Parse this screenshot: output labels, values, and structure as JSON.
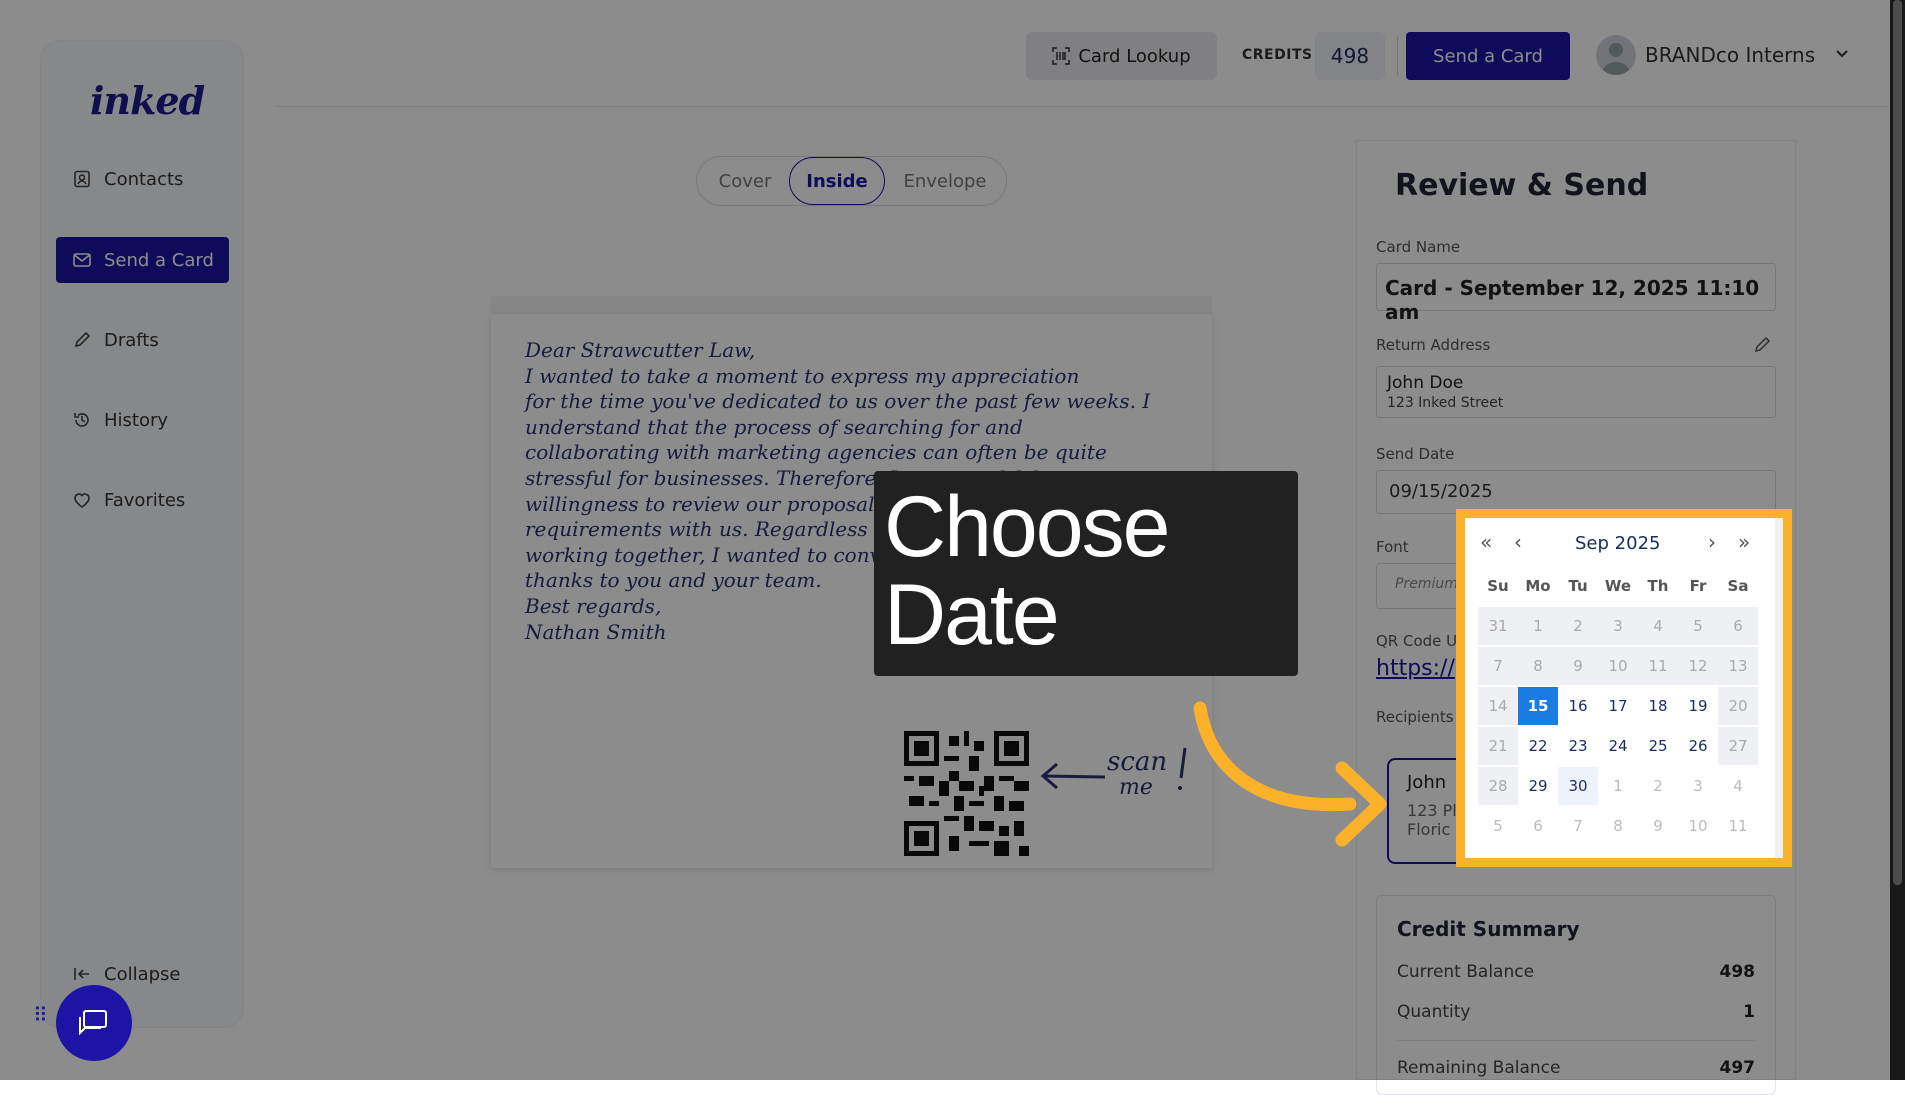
{
  "app": {
    "logo": "inked"
  },
  "header": {
    "card_lookup": "Card Lookup",
    "credits_label": "CREDITS",
    "credits_value": "498",
    "send_card": "Send a Card",
    "user_name": "BRANDco Interns"
  },
  "sidebar": {
    "items": [
      {
        "label": "Contacts",
        "icon": "contacts-icon"
      },
      {
        "label": "Send a Card",
        "icon": "mail-icon"
      },
      {
        "label": "Drafts",
        "icon": "pencil-icon"
      },
      {
        "label": "History",
        "icon": "history-icon"
      },
      {
        "label": "Favorites",
        "icon": "heart-icon"
      }
    ],
    "collapse": "Collapse"
  },
  "tabs": [
    "Cover",
    "Inside",
    "Envelope"
  ],
  "active_tab": "Inside",
  "card": {
    "lines": [
      "Dear Strawcutter Law,",
      "I wanted to take a moment to express my appreciation",
      "for the time you've dedicated to us over the past few weeks. I",
      "understand that the process of searching for and",
      "collaborating with marketing agencies can often be quite",
      "stressful for businesses. Therefore, I am grateful for your",
      "willingness to review our proposal and discuss your",
      "requirements with us. Regardless of the outcome, in",
      "working together, I wanted to convey my sincere",
      "thanks to you and your team.",
      "Best regards,",
      "Nathan Smith"
    ],
    "scan_text_1": "scan",
    "scan_text_2": "me"
  },
  "panel": {
    "title": "Review & Send",
    "card_name_label": "Card Name",
    "card_name_value": "Card - September 12, 2025 11:10 am",
    "return_address_label": "Return Address",
    "return_name": "John Doe",
    "return_street": "123 Inked Street",
    "send_date_label": "Send Date",
    "send_date_value": "09/15/2025",
    "font_label": "Font",
    "font_value": "Premium",
    "qr_label": "QR Code U",
    "qr_value": "https://",
    "recipients_label": "Recipients",
    "recipient_name": "John",
    "recipient_line1": "123 Pl",
    "recipient_line2": "Floric",
    "credit_summary": {
      "title": "Credit Summary",
      "rows": [
        {
          "label": "Current Balance",
          "value": "498"
        },
        {
          "label": "Quantity",
          "value": "1"
        },
        {
          "label": "Remaining Balance",
          "value": "497"
        }
      ]
    }
  },
  "tooltip": {
    "line1": "Choose",
    "line2": "Date"
  },
  "calendar": {
    "month": "Sep",
    "year": "2025",
    "dow": [
      "Su",
      "Mo",
      "Tu",
      "We",
      "Th",
      "Fr",
      "Sa"
    ],
    "weeks": [
      [
        "31",
        "1",
        "2",
        "3",
        "4",
        "5",
        "6"
      ],
      [
        "7",
        "8",
        "9",
        "10",
        "11",
        "12",
        "13"
      ],
      [
        "14",
        "15",
        "16",
        "17",
        "18",
        "19",
        "20"
      ],
      [
        "21",
        "22",
        "23",
        "24",
        "25",
        "26",
        "27"
      ],
      [
        "28",
        "29",
        "30",
        "1",
        "2",
        "3",
        "4"
      ],
      [
        "5",
        "6",
        "7",
        "8",
        "9",
        "10",
        "11"
      ]
    ],
    "selected": "15",
    "colors": {
      "selected": "#1a7be0",
      "highlight": "#fbb22a"
    }
  },
  "colors": {
    "brand": "#1d14a6"
  }
}
